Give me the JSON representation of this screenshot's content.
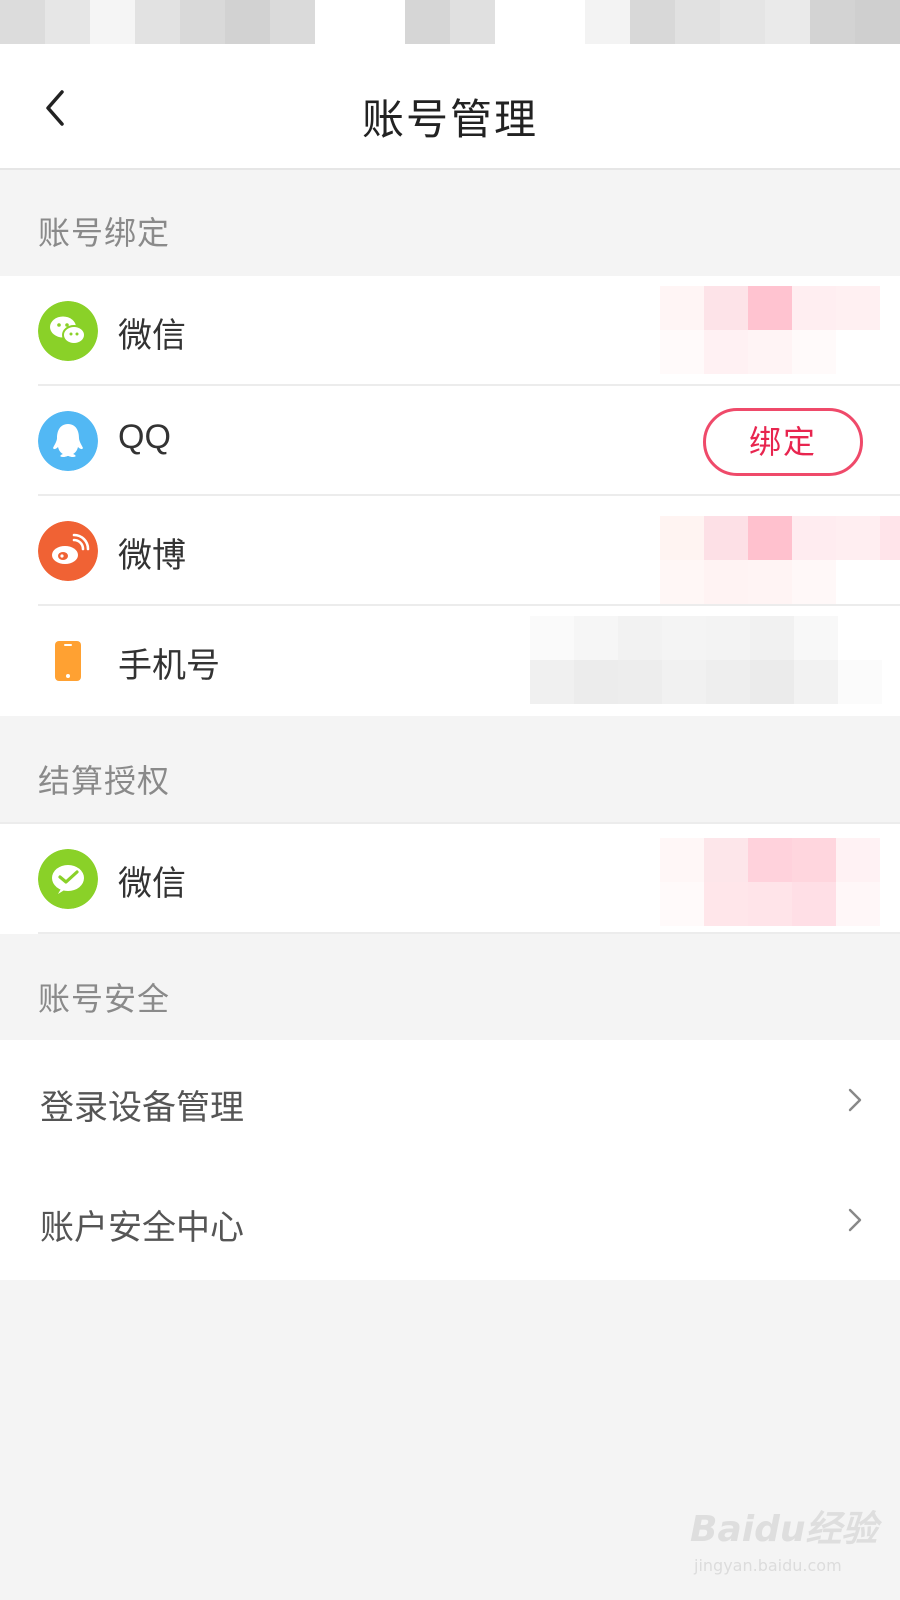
{
  "header": {
    "title": "账号管理"
  },
  "sections": {
    "binding": {
      "title": "账号绑定",
      "items": [
        {
          "label": "微信",
          "icon": "wechat-icon",
          "color": "#8ad128"
        },
        {
          "label": "QQ",
          "icon": "qq-icon",
          "color": "#52b8f4",
          "action": "绑定"
        },
        {
          "label": "微博",
          "icon": "weibo-icon",
          "color": "#f06234"
        },
        {
          "label": "手机号",
          "icon": "phone-icon",
          "color": "#ffa132"
        }
      ]
    },
    "settlement": {
      "title": "结算授权",
      "items": [
        {
          "label": "微信",
          "icon": "wechat-pay-icon",
          "color": "#8ad128"
        }
      ]
    },
    "security": {
      "title": "账号安全",
      "items": [
        {
          "label": "登录设备管理",
          "icon": "chevron-right-icon"
        },
        {
          "label": "账户安全中心",
          "icon": "chevron-right-icon"
        }
      ]
    }
  },
  "watermark": {
    "brand": "Baidu经验",
    "url": "jingyan.baidu.com"
  },
  "colors": {
    "accent": "#e8254f",
    "background": "#f4f4f4"
  }
}
